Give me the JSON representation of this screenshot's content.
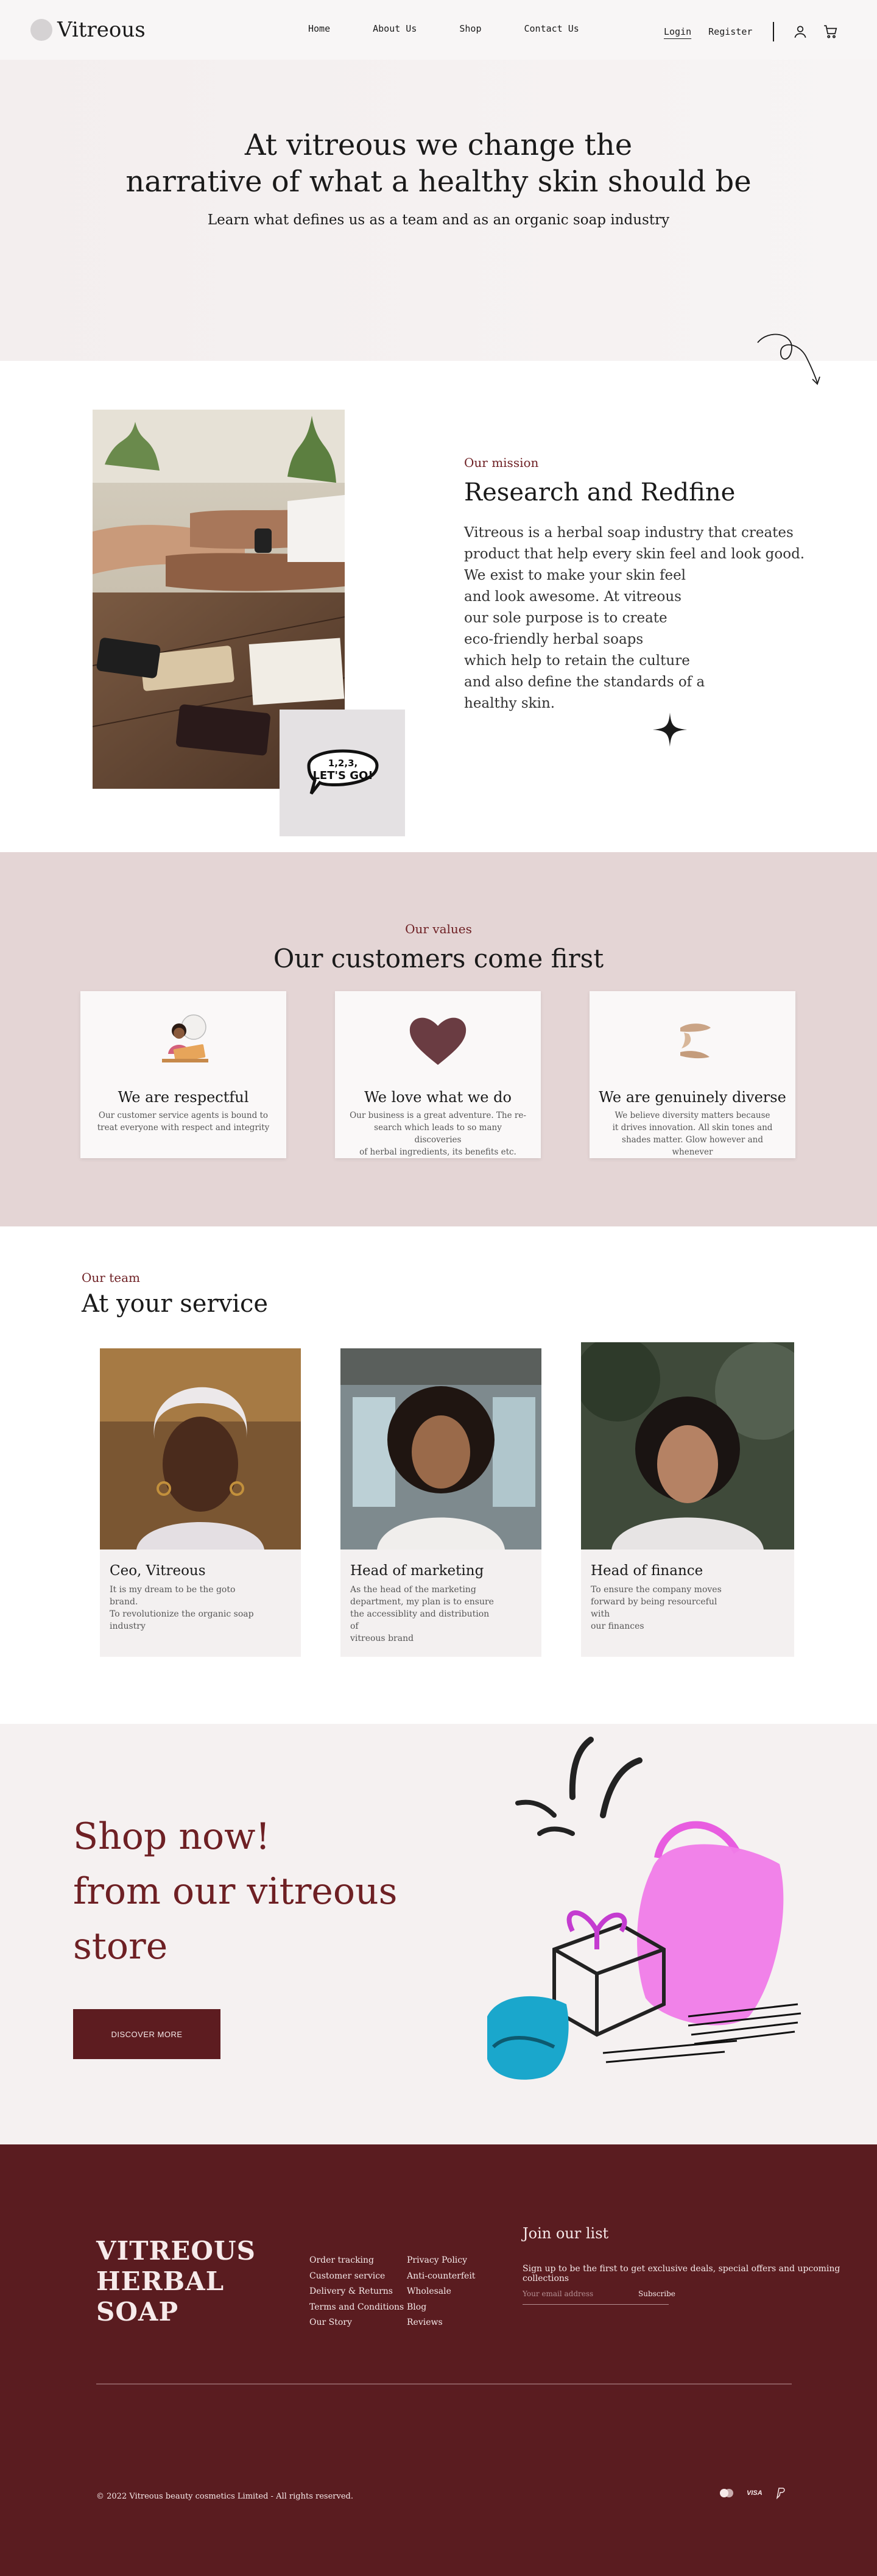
{
  "nav": {
    "logo": "Vitreous",
    "links": [
      "Home",
      "About Us",
      "Shop",
      "Contact Us"
    ],
    "login": "Login",
    "register": "Register"
  },
  "hero": {
    "title_line1": "At vitreous we change the",
    "title_line2": "narrative of what a healthy skin should be",
    "subtitle": "Learn what defines us as a team and as an organic soap industry"
  },
  "mission": {
    "eyebrow": "Our mission",
    "title": "Research and Redfine",
    "body_lines": [
      "Vitreous is a herbal soap industry that creates",
      "product that help every skin feel and look good.",
      "We exist to make your skin feel",
      "and look awesome. At vitreous",
      "our sole purpose is to create",
      "eco-friendly herbal soaps",
      "which help to retain the culture",
      "and also define the standards of a",
      "healthy skin."
    ],
    "sticker_text": "1,2,3, LET'S GO!"
  },
  "values": {
    "eyebrow": "Our values",
    "title": "Our customers come first",
    "cards": [
      {
        "title": "We are respectful",
        "lines": [
          "Our customer service agents is bound to",
          "treat everyone with respect and integrity"
        ]
      },
      {
        "title": "We love what we do",
        "lines": [
          "Our business is a great adventure. The re-",
          "search which leads to so many discoveries",
          "of herbal ingredients, its benefits etc."
        ]
      },
      {
        "title": "We are genuinely diverse",
        "lines": [
          "We believe diversity matters because",
          "it drives innovation. All skin tones and",
          "shades matter. Glow however and whenever"
        ]
      }
    ]
  },
  "team": {
    "eyebrow": "Our team",
    "title": "At your service",
    "members": [
      {
        "role": "Ceo, Vitreous",
        "lines": [
          "It is my dream to be the goto brand.",
          "To revolutionize the organic soap",
          "industry"
        ]
      },
      {
        "role": "Head of marketing",
        "lines": [
          "As the head of the marketing",
          "department, my plan is to ensure",
          "the accessiblity and distribution of",
          "vitreous brand"
        ]
      },
      {
        "role": "Head of finance",
        "lines": [
          "To ensure the company moves",
          "forward by being resourceful with",
          "our finances"
        ]
      }
    ]
  },
  "shop": {
    "lines": [
      "Shop now!",
      "from our vitreous",
      "store"
    ],
    "button": "DISCOVER MORE"
  },
  "footer": {
    "brand_lines": [
      "VITREOUS",
      "HERBAL",
      "SOAP"
    ],
    "col1": [
      "Order tracking",
      "Customer service",
      "Delivery & Returns",
      "Terms and Conditions",
      "Our Story"
    ],
    "col2": [
      "Privacy Policy",
      "Anti-counterfeit",
      "Wholesale",
      "Blog",
      "Reviews"
    ],
    "join_title": "Join our list",
    "join_sub": "Sign up to be the first to get exclusive deals, special offers and upcoming collections",
    "email_placeholder": "Your email address",
    "subscribe": "Subscribe",
    "copyright": "©   2022 Vitreous beauty cosmetics Limited - All rights reserved.",
    "payments": [
      "mastercard-icon",
      "visa-icon",
      "paypal-icon"
    ],
    "visa_text": "VISA"
  },
  "colors": {
    "maroon": "#5a1c20",
    "accent": "#6e2024",
    "values_bg": "#e4d5d5",
    "hero_bg": "#f3eeee"
  }
}
